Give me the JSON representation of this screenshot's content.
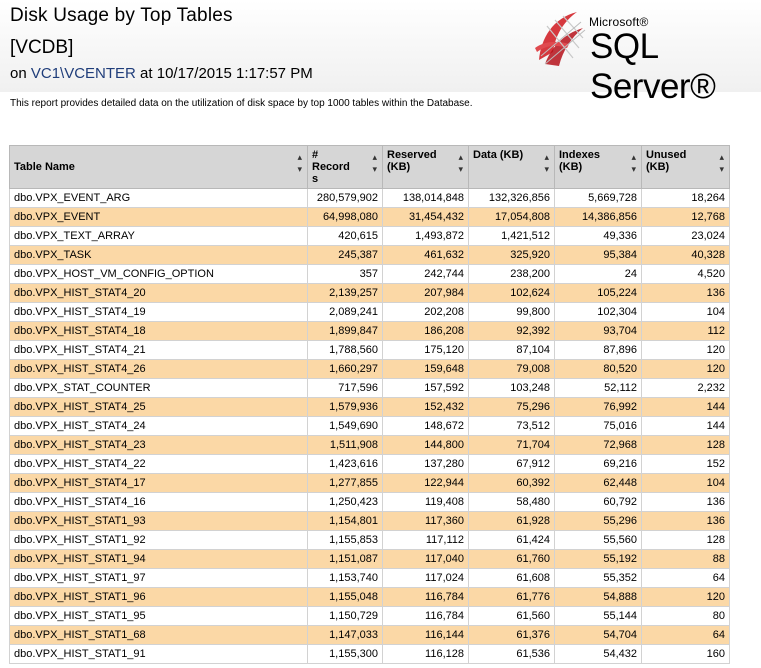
{
  "report": {
    "title": "Disk Usage by Top Tables",
    "database": "[VCDB]",
    "on_prefix": "on ",
    "server": "VC1\\VCENTER",
    "at_text": " at 10/17/2015 1:17:57 PM",
    "description": "This report provides detailed data on the utilization of disk space by top 1000 tables within the Database."
  },
  "logo": {
    "brand": "Microsoft®",
    "product": "SQL Server®",
    "icon": "sql-server-logo-icon",
    "accent_color": "#d2232a"
  },
  "table": {
    "columns": [
      {
        "label": "Table Name",
        "sort_icon": "sort-arrows-icon"
      },
      {
        "label": "# Record s",
        "sort_icon": "sort-arrows-icon"
      },
      {
        "label": "Reserved (KB)",
        "sort_icon": "sort-arrows-icon"
      },
      {
        "label": "Data (KB)",
        "sort_icon": "sort-arrows-icon"
      },
      {
        "label": "Indexes (KB)",
        "sort_icon": "sort-arrows-icon"
      },
      {
        "label": "Unused (KB)",
        "sort_icon": "sort-arrows-icon"
      }
    ],
    "rows": [
      [
        "dbo.VPX_EVENT_ARG",
        "280,579,902",
        "138,014,848",
        "132,326,856",
        "5,669,728",
        "18,264"
      ],
      [
        "dbo.VPX_EVENT",
        "64,998,080",
        "31,454,432",
        "17,054,808",
        "14,386,856",
        "12,768"
      ],
      [
        "dbo.VPX_TEXT_ARRAY",
        "420,615",
        "1,493,872",
        "1,421,512",
        "49,336",
        "23,024"
      ],
      [
        "dbo.VPX_TASK",
        "245,387",
        "461,632",
        "325,920",
        "95,384",
        "40,328"
      ],
      [
        "dbo.VPX_HOST_VM_CONFIG_OPTION",
        "357",
        "242,744",
        "238,200",
        "24",
        "4,520"
      ],
      [
        "dbo.VPX_HIST_STAT4_20",
        "2,139,257",
        "207,984",
        "102,624",
        "105,224",
        "136"
      ],
      [
        "dbo.VPX_HIST_STAT4_19",
        "2,089,241",
        "202,208",
        "99,800",
        "102,304",
        "104"
      ],
      [
        "dbo.VPX_HIST_STAT4_18",
        "1,899,847",
        "186,208",
        "92,392",
        "93,704",
        "112"
      ],
      [
        "dbo.VPX_HIST_STAT4_21",
        "1,788,560",
        "175,120",
        "87,104",
        "87,896",
        "120"
      ],
      [
        "dbo.VPX_HIST_STAT4_26",
        "1,660,297",
        "159,648",
        "79,008",
        "80,520",
        "120"
      ],
      [
        "dbo.VPX_STAT_COUNTER",
        "717,596",
        "157,592",
        "103,248",
        "52,112",
        "2,232"
      ],
      [
        "dbo.VPX_HIST_STAT4_25",
        "1,579,936",
        "152,432",
        "75,296",
        "76,992",
        "144"
      ],
      [
        "dbo.VPX_HIST_STAT4_24",
        "1,549,690",
        "148,672",
        "73,512",
        "75,016",
        "144"
      ],
      [
        "dbo.VPX_HIST_STAT4_23",
        "1,511,908",
        "144,800",
        "71,704",
        "72,968",
        "128"
      ],
      [
        "dbo.VPX_HIST_STAT4_22",
        "1,423,616",
        "137,280",
        "67,912",
        "69,216",
        "152"
      ],
      [
        "dbo.VPX_HIST_STAT4_17",
        "1,277,855",
        "122,944",
        "60,392",
        "62,448",
        "104"
      ],
      [
        "dbo.VPX_HIST_STAT4_16",
        "1,250,423",
        "119,408",
        "58,480",
        "60,792",
        "136"
      ],
      [
        "dbo.VPX_HIST_STAT1_93",
        "1,154,801",
        "117,360",
        "61,928",
        "55,296",
        "136"
      ],
      [
        "dbo.VPX_HIST_STAT1_92",
        "1,155,853",
        "117,112",
        "61,424",
        "55,560",
        "128"
      ],
      [
        "dbo.VPX_HIST_STAT1_94",
        "1,151,087",
        "117,040",
        "61,760",
        "55,192",
        "88"
      ],
      [
        "dbo.VPX_HIST_STAT1_97",
        "1,153,740",
        "117,024",
        "61,608",
        "55,352",
        "64"
      ],
      [
        "dbo.VPX_HIST_STAT1_96",
        "1,155,048",
        "116,784",
        "61,776",
        "54,888",
        "120"
      ],
      [
        "dbo.VPX_HIST_STAT1_95",
        "1,150,729",
        "116,784",
        "61,560",
        "55,144",
        "80"
      ],
      [
        "dbo.VPX_HIST_STAT1_68",
        "1,147,033",
        "116,144",
        "61,376",
        "54,704",
        "64"
      ],
      [
        "dbo.VPX_HIST_STAT1_91",
        "1,155,300",
        "116,128",
        "61,536",
        "54,432",
        "160"
      ]
    ]
  }
}
